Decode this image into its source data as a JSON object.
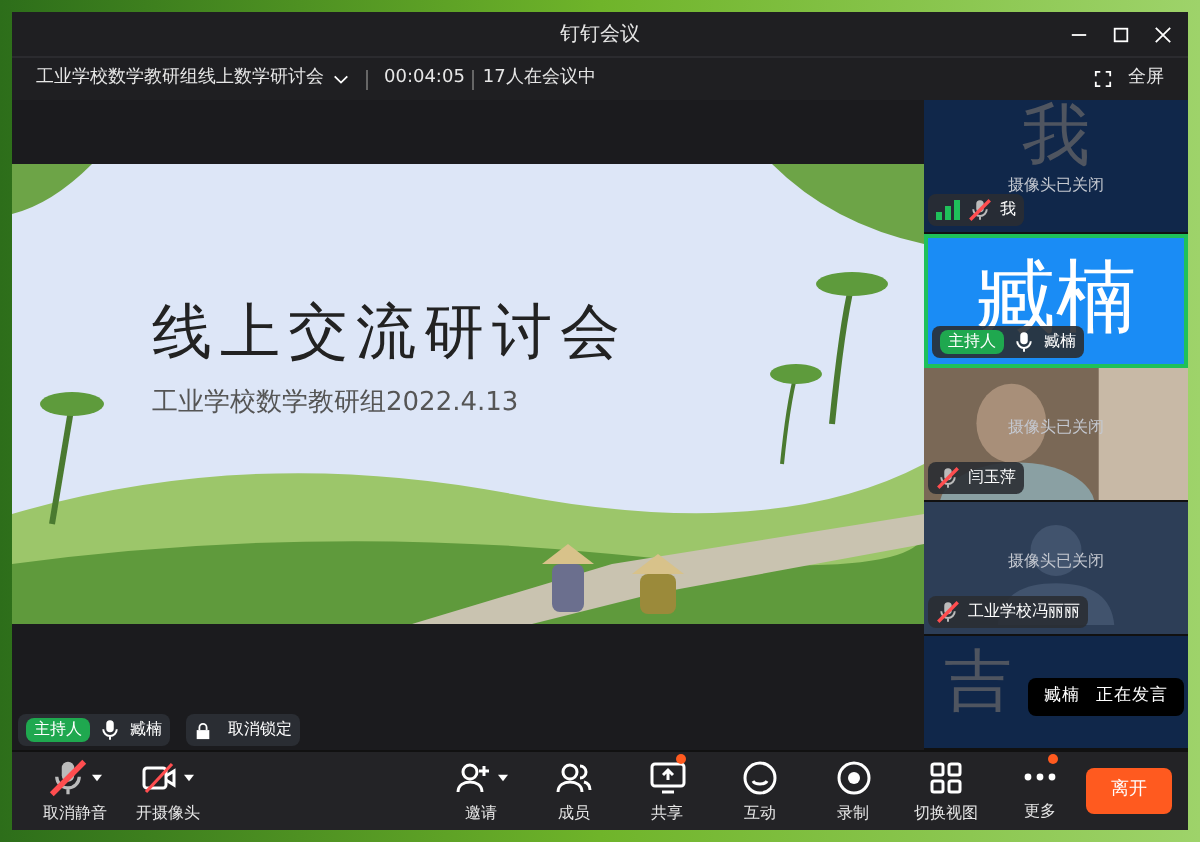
{
  "window": {
    "title": "钉钉会议"
  },
  "info_bar": {
    "meeting_name": "工业学校数学教研组线上数学研讨会",
    "duration": "00:04:05",
    "participants": "17人在会议中",
    "fullscreen": "全屏"
  },
  "slide": {
    "title": "线上交流研讨会",
    "subtitle": "工业学校数学教研组2022.4.13"
  },
  "presenter": {
    "badge": "主持人",
    "name": "臧楠",
    "muted": false,
    "lock_button": "取消锁定"
  },
  "tiles": [
    {
      "kind": "text",
      "big_text": "我",
      "camera_note": "摄像头已关闭",
      "name": "我",
      "muted": true,
      "signal": true,
      "selected": false
    },
    {
      "kind": "host",
      "big_text": "臧楠",
      "badge": "主持人",
      "name": "臧楠",
      "muted": false,
      "signal": false,
      "selected": true
    },
    {
      "camera_note": "摄像头已关闭",
      "name": "闫玉萍",
      "muted": true,
      "signal": false,
      "selected": false
    },
    {
      "kind": "silhouette",
      "camera_note": "摄像头已关闭",
      "name": "工业学校冯丽丽",
      "muted": true,
      "signal": false,
      "selected": false
    },
    {
      "kind": "text",
      "big_text": "吉",
      "selected": false
    }
  ],
  "speaking_popup": {
    "name": "臧楠",
    "status": "正在发言"
  },
  "toolbar": [
    {
      "label": "取消静音",
      "kind": "mic",
      "off": true,
      "caret": true,
      "dot": false
    },
    {
      "label": "开摄像头",
      "kind": "camera",
      "off": true,
      "caret": true,
      "dot": false
    },
    {
      "label": "邀请",
      "kind": "invite",
      "caret": true,
      "dot": false
    },
    {
      "label": "成员",
      "kind": "members",
      "caret": false,
      "dot": false
    },
    {
      "label": "共享",
      "kind": "share",
      "caret": false,
      "dot": true
    },
    {
      "label": "互动",
      "kind": "chat",
      "caret": false,
      "dot": false
    },
    {
      "label": "录制",
      "kind": "record",
      "caret": false,
      "dot": false
    },
    {
      "label": "切换视图",
      "kind": "grid",
      "caret": false,
      "dot": false
    },
    {
      "label": "更多",
      "kind": "more",
      "caret": false,
      "dot": true
    }
  ],
  "leave_button": "离开"
}
